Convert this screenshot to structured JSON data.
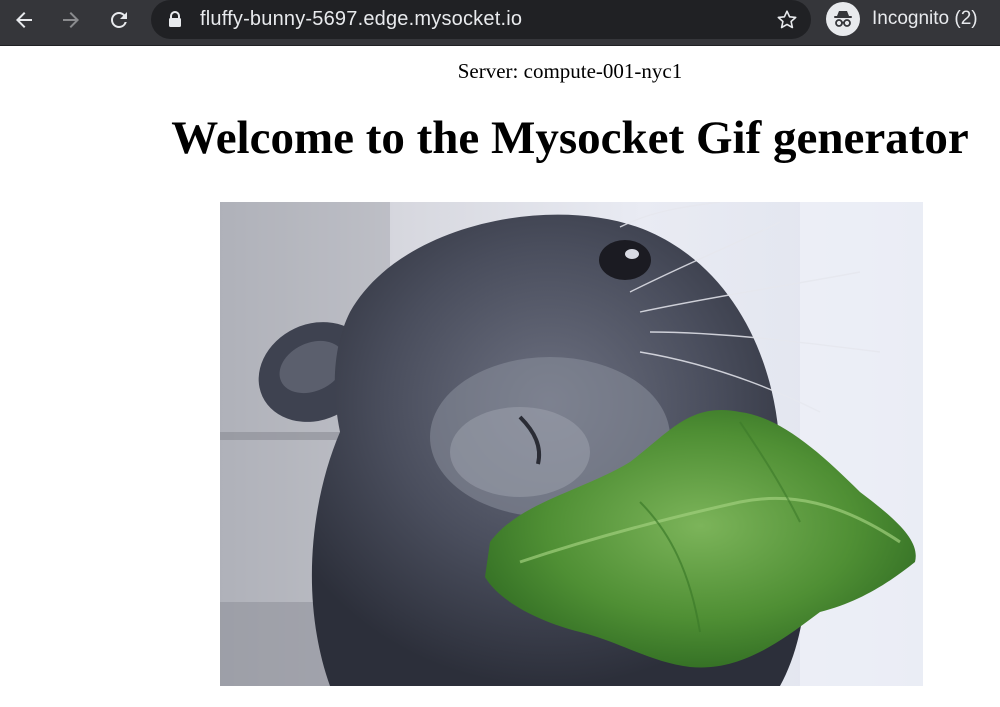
{
  "browser": {
    "url": "fluffy-bunny-5697.edge.mysocket.io",
    "profile_label": "Incognito (2)",
    "icons": {
      "back": "arrow-left-icon",
      "forward": "arrow-right-icon",
      "reload": "reload-icon",
      "lock": "lock-icon",
      "bookmark": "star-icon",
      "profile": "incognito-icon"
    },
    "colors": {
      "toolbar": "#35363a",
      "omnibox": "#202124",
      "text": "#e8eaed"
    }
  },
  "page": {
    "server_line": "Server: compute-001-nyc1",
    "title": "Welcome to the Mysocket Gif generator",
    "image": {
      "subject": "rabbit eating lettuce"
    }
  }
}
